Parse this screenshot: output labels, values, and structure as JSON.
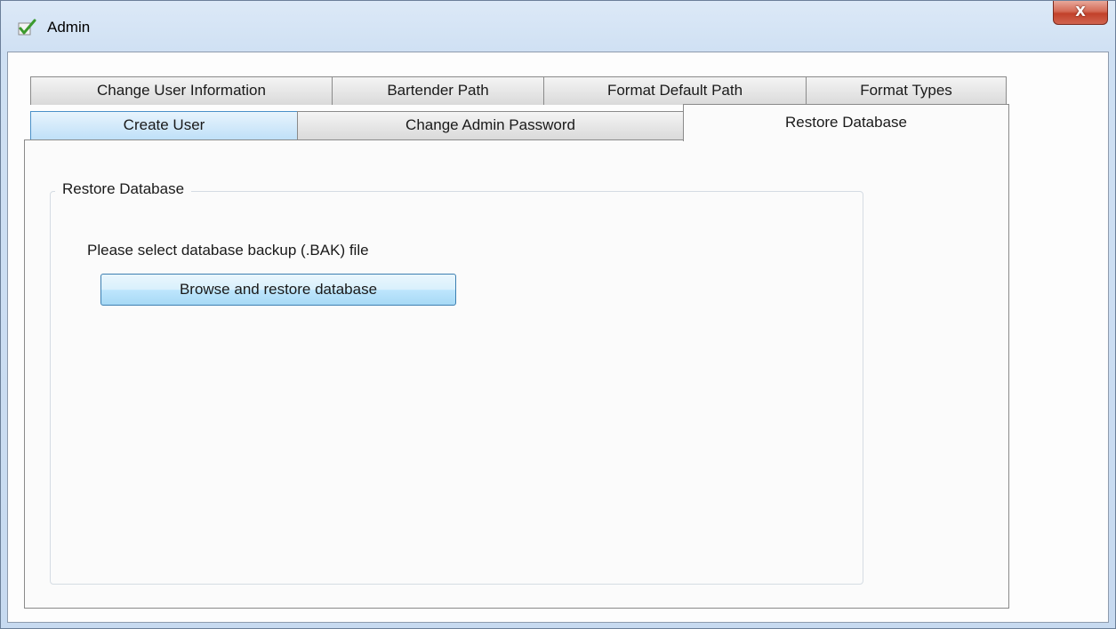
{
  "window": {
    "title": "Admin",
    "close_glyph": "X"
  },
  "tabs_row1": [
    {
      "label": "Change User Information"
    },
    {
      "label": "Bartender Path"
    },
    {
      "label": "Format Default Path"
    },
    {
      "label": "Format Types"
    }
  ],
  "tabs_row2": [
    {
      "label": "Create User"
    },
    {
      "label": "Change Admin Password"
    },
    {
      "label": "Restore Database",
      "selected": true
    }
  ],
  "restore": {
    "group_title": "Restore Database",
    "prompt": "Please select database backup (.BAK) file",
    "browse_label": "Browse and restore database"
  },
  "icons": {
    "app": "checkmark-icon",
    "close": "close-icon"
  },
  "colors": {
    "close_button": "#c7432c",
    "hover_tab": "#bfe0f8",
    "button_accent": "#3c7fb1"
  }
}
